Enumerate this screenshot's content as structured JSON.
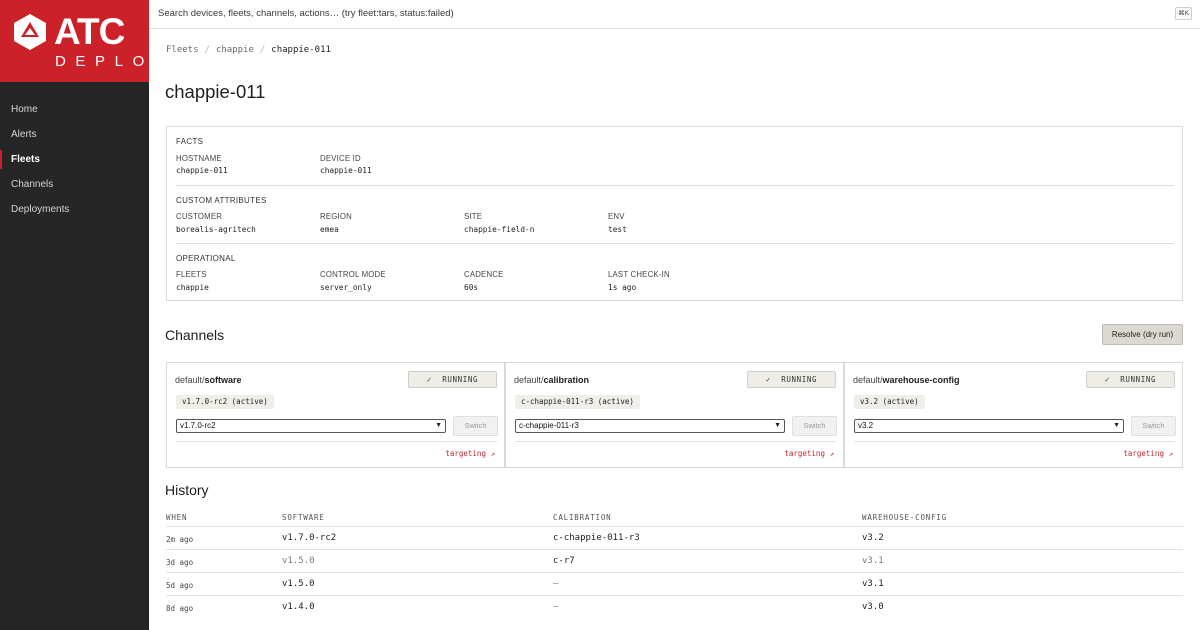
{
  "app": {
    "logo_title": "ATC",
    "logo_subtitle": "DEPLOY",
    "brand_color": "#cc2128"
  },
  "sidebar": {
    "items": [
      {
        "label": "Home",
        "active": false
      },
      {
        "label": "Alerts",
        "active": false
      },
      {
        "label": "Fleets",
        "active": true
      },
      {
        "label": "Channels",
        "active": false
      },
      {
        "label": "Deployments",
        "active": false
      }
    ]
  },
  "search": {
    "placeholder": "Search devices, fleets, channels, actions… (try fleet:tars, status:failed)",
    "shortcut": "⌘K"
  },
  "breadcrumb": [
    "Fleets",
    "chappie",
    "chappie-011"
  ],
  "page_title": "chappie-011",
  "facts": {
    "section_label": "FACTS",
    "fields": [
      {
        "label": "HOSTNAME",
        "value": "chappie-011"
      },
      {
        "label": "DEVICE ID",
        "value": "chappie-011"
      }
    ]
  },
  "custom_attributes": {
    "section_label": "CUSTOM ATTRIBUTES",
    "fields": [
      {
        "label": "CUSTOMER",
        "value": "borealis-agritech"
      },
      {
        "label": "REGION",
        "value": "emea"
      },
      {
        "label": "SITE",
        "value": "chappie-field-n"
      },
      {
        "label": "ENV",
        "value": "test"
      }
    ]
  },
  "operational": {
    "section_label": "OPERATIONAL",
    "fields": [
      {
        "label": "FLEETS",
        "value": "chappie"
      },
      {
        "label": "CONTROL MODE",
        "value": "server_only"
      },
      {
        "label": "CADENCE",
        "value": "60s"
      },
      {
        "label": "LAST CHECK-IN",
        "value": "1s ago"
      }
    ]
  },
  "channels": {
    "title": "Channels",
    "resolve_label": "Resolve (dry run)",
    "cards": [
      {
        "prefix": "default/",
        "name": "software",
        "status": "RUNNING",
        "active_version": "v1.7.0-rc2 (active)",
        "selected": "v1.7.0-rc2",
        "switch_label": "Switch",
        "targeting_label": "targeting ↗"
      },
      {
        "prefix": "default/",
        "name": "calibration",
        "status": "RUNNING",
        "active_version": "c-chappie-011-r3 (active)",
        "selected": "c-chappie-011-r3",
        "switch_label": "Switch",
        "targeting_label": "targeting ↗"
      },
      {
        "prefix": "default/",
        "name": "warehouse-config",
        "status": "RUNNING",
        "active_version": "v3.2 (active)",
        "selected": "v3.2",
        "switch_label": "Switch",
        "targeting_label": "targeting ↗"
      }
    ]
  },
  "history": {
    "title": "History",
    "columns": [
      "WHEN",
      "SOFTWARE",
      "CALIBRATION",
      "WAREHOUSE-CONFIG"
    ],
    "rows": [
      {
        "when": "2m ago",
        "software": "v1.7.0-rc2",
        "calibration": "c-chappie-011-r3",
        "warehouse": "v3.2",
        "dim": [
          false,
          false,
          false
        ]
      },
      {
        "when": "3d ago",
        "software": "v1.5.0",
        "calibration": "c-r7",
        "warehouse": "v3.1",
        "dim": [
          true,
          false,
          true
        ]
      },
      {
        "when": "5d ago",
        "software": "v1.5.0",
        "calibration": "—",
        "warehouse": "v3.1",
        "dim": [
          false,
          true,
          false
        ]
      },
      {
        "when": "8d ago",
        "software": "v1.4.0",
        "calibration": "—",
        "warehouse": "v3.0",
        "dim": [
          false,
          true,
          false
        ]
      }
    ]
  }
}
